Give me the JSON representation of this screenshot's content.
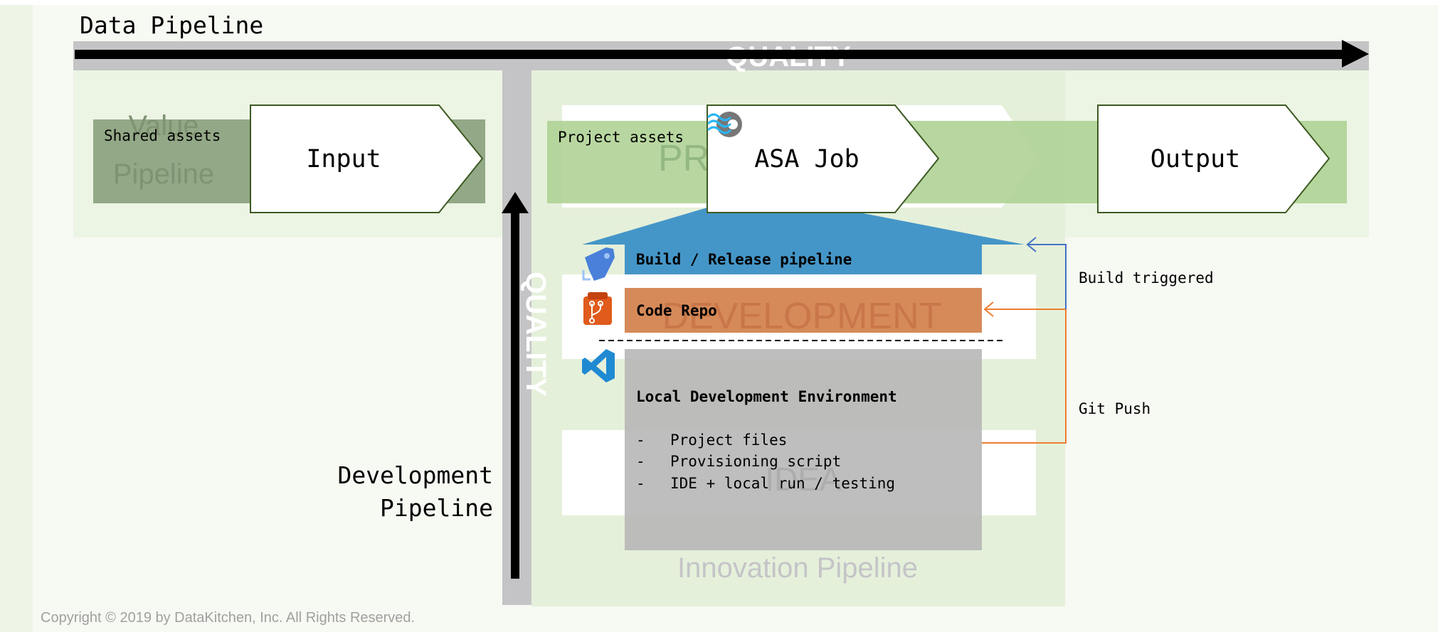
{
  "title": "Data Pipeline",
  "quality_label": "QUALITY",
  "value_pipeline_watermark": [
    "Value",
    "Pipeline"
  ],
  "production_watermark": "PR",
  "development_watermark": "DEVELOPMENT",
  "idea_watermark": "IDEA",
  "innovation_pipeline": "Innovation Pipeline",
  "development_pipeline": [
    "Development",
    "Pipeline"
  ],
  "shared_assets": "Shared assets",
  "project_assets": "Project assets",
  "steps": {
    "input": "Input",
    "asa_job": "ASA Job",
    "output": "Output"
  },
  "build_release": "Build / Release pipeline",
  "code_repo": "Code Repo",
  "local_env": {
    "title": "Local Development Environment",
    "items": [
      {
        "bullet": "-",
        "text": "Project files"
      },
      {
        "bullet": "-",
        "text": "Provisioning script"
      },
      {
        "bullet": "-",
        "text": "IDE + local run / testing"
      }
    ]
  },
  "build_triggered": "Build triggered",
  "git_push": "Git Push",
  "copyright": "Copyright © 2019 by DataKitchen, Inc.  All Rights Reserved.",
  "colors": {
    "build": "#4596c8",
    "repo": "#d68a59",
    "trigger_line": "#4472c4",
    "push_line": "#ed7d31"
  }
}
